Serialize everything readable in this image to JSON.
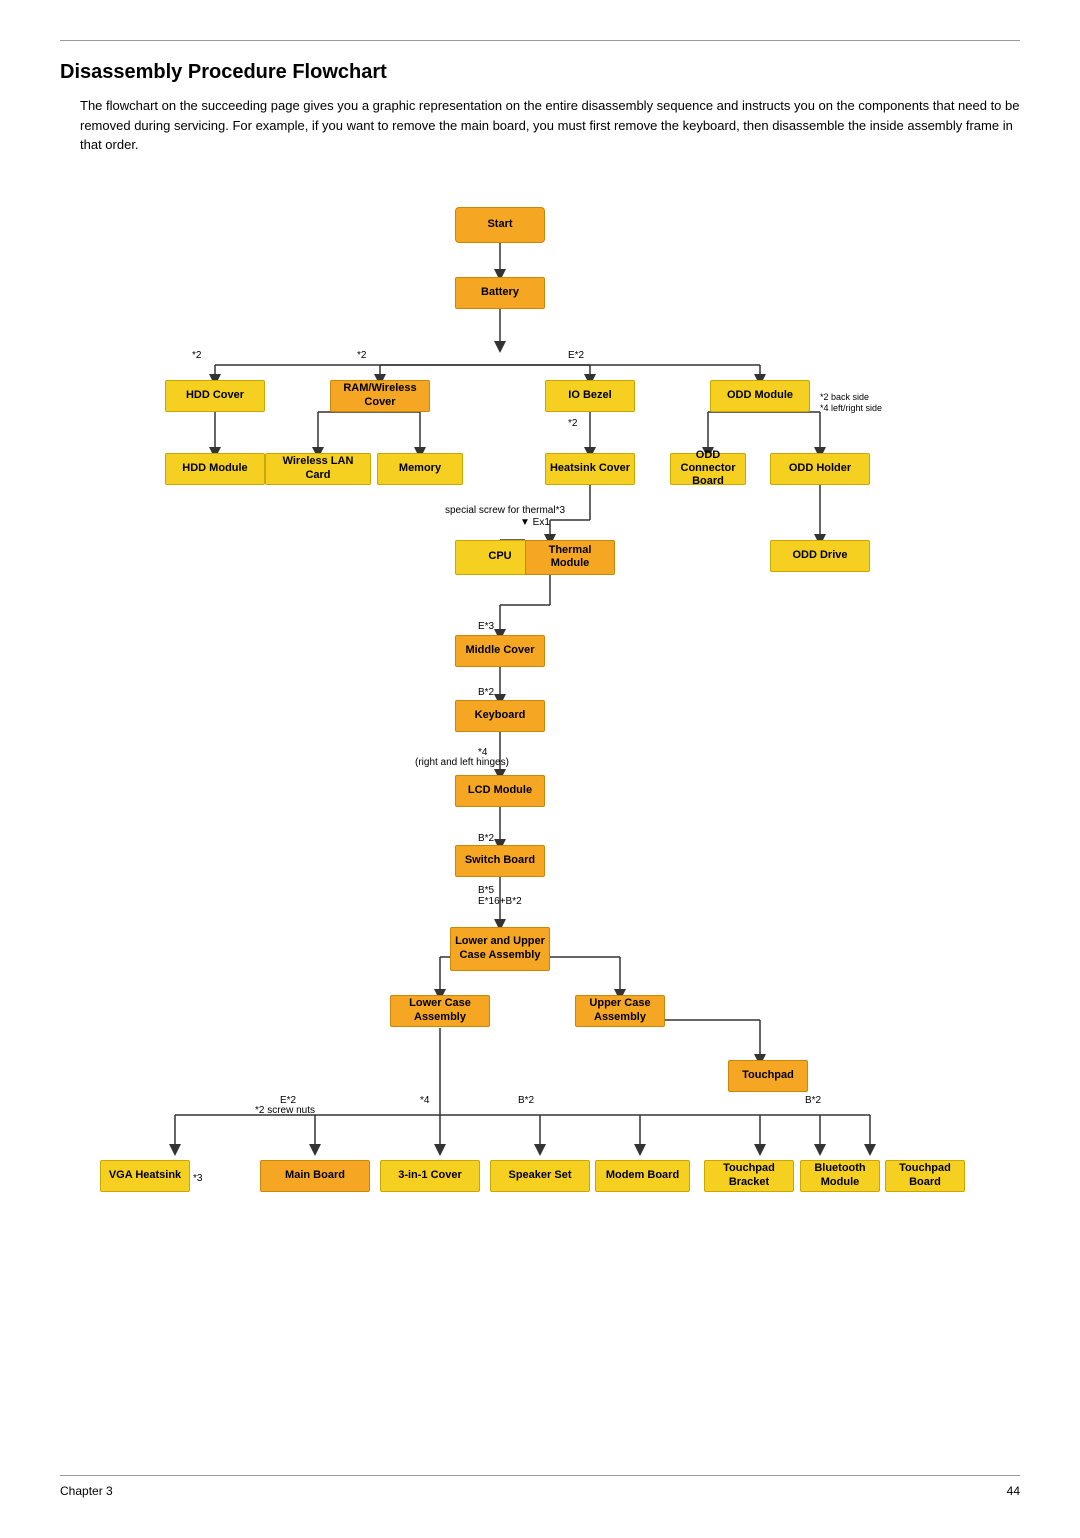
{
  "page": {
    "title": "Disassembly Procedure Flowchart",
    "description": "The flowchart on the succeeding page gives you a graphic representation on the entire disassembly sequence and instructs you on the components that need to be removed during servicing. For example, if you want to remove the main board, you must first remove the keyboard, then disassemble the inside assembly frame in that order.",
    "footer_left": "Chapter 3",
    "footer_right": "44"
  },
  "nodes": {
    "start": "Start",
    "battery": "Battery",
    "hdd_cover": "HDD Cover",
    "ram_wireless_cover": "RAM/Wireless Cover",
    "io_bezel": "IO Bezel",
    "odd_module": "ODD Module",
    "hdd_module": "HDD Module",
    "wireless_lan": "Wireless LAN Card",
    "memory": "Memory",
    "heatsink_cover": "Heatsink Cover",
    "odd_connector_board": "ODD Connector Board",
    "odd_holder": "ODD Holder",
    "cpu": "CPU",
    "thermal_module": "Thermal Module",
    "odd_drive": "ODD Drive",
    "middle_cover": "Middle Cover",
    "keyboard": "Keyboard",
    "lcd_module": "LCD Module",
    "switch_board": "Switch Board",
    "lower_upper_case": "Lower and Upper Case Assembly",
    "lower_case": "Lower Case Assembly",
    "upper_case": "Upper Case Assembly",
    "touchpad": "Touchpad",
    "vga_heatsink": "VGA Heatsink",
    "main_board": "Main Board",
    "cover_3in1": "3-in-1 Cover",
    "speaker_set": "Speaker Set",
    "modem_board": "Modem Board",
    "touchpad_bracket": "Touchpad Bracket",
    "bluetooth_module": "Bluetooth Module",
    "touchpad_board": "Touchpad Board"
  },
  "labels": {
    "star2_1": "*2",
    "star2_2": "*2",
    "starE2_1": "E*2",
    "star2_3": "*2",
    "back_side": "*2 back side",
    "left_right_side": "*4 left/right side",
    "special_screw": "special screw for thermal*3",
    "ex1": "▼ Ex1",
    "starE3": "E*3",
    "starB2_1": "B*2",
    "star4_hinges": "*4",
    "right_left_hinges": "(right and left hinges)",
    "starB2_2": "B*2",
    "starB5_E16_B2": "B*5\nE*16+B*2",
    "starE2_2": "E*2",
    "star2_screw": "*2 screw nuts",
    "star4_2": "*4",
    "starB2_3": "B*2",
    "starB2_4": "B*2",
    "star3": "*3"
  }
}
